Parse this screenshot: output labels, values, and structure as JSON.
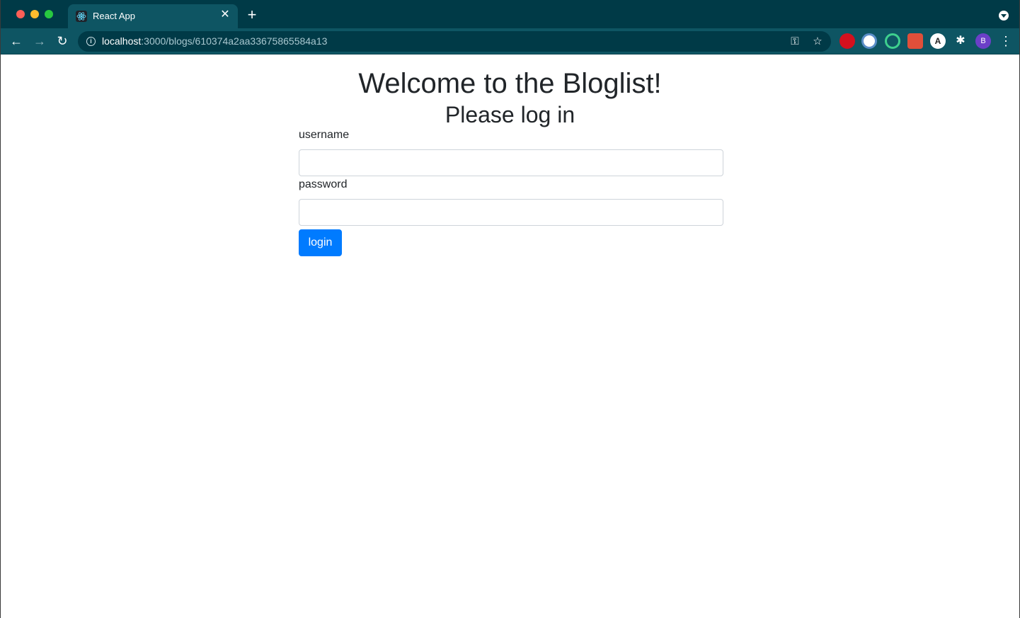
{
  "browser": {
    "tab": {
      "title": "React App",
      "icon": "react-icon"
    },
    "url": {
      "host": "localhost",
      "path": ":3000/blogs/610374a2aa33675865584a13"
    },
    "avatar_letter": "B",
    "extension_label": "A"
  },
  "page": {
    "title": "Welcome to the Bloglist!",
    "subtitle": "Please log in",
    "form": {
      "username_label": "username",
      "username_value": "",
      "password_label": "password",
      "password_value": "",
      "login_label": "login"
    }
  },
  "colors": {
    "primary": "#007bff",
    "titlebar": "#003a47",
    "toolbar": "#0e5563"
  }
}
